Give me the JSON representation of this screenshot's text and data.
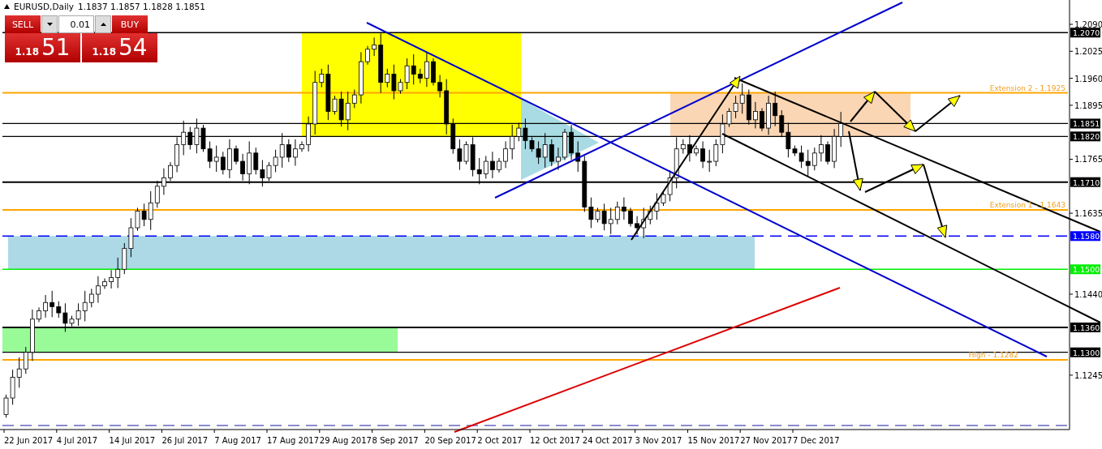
{
  "symbol": {
    "title": "EURUSD,Daily",
    "ohlc": "1.1837 1.1857 1.1828 1.1851"
  },
  "trade_panel": {
    "sell_label": "SELL",
    "buy_label": "BUY",
    "lot": "0.01",
    "sell_price": {
      "prefix": "1.18",
      "big": "51"
    },
    "buy_price": {
      "prefix": "1.18",
      "big": "54"
    }
  },
  "y_ticks": [
    "1.2090",
    "1.2025",
    "1.1960",
    "1.1895",
    "1.1765",
    "1.1635",
    "1.1440",
    "1.1245"
  ],
  "price_labels": [
    {
      "text": "1.2070",
      "color": "#000000"
    },
    {
      "text": "1.1851",
      "color": "#000000"
    },
    {
      "text": "1.1820",
      "color": "#000000"
    },
    {
      "text": "1.1710",
      "color": "#000000"
    },
    {
      "text": "1.1580",
      "color": "#0000ff"
    },
    {
      "text": "1.1500",
      "color": "#00ee00"
    },
    {
      "text": "1.1360",
      "color": "#000000"
    },
    {
      "text": "1.1300",
      "color": "#000000"
    }
  ],
  "line_notes": [
    "Extension 2 - 1.1925",
    "Extension 1 - 1.1643",
    "High - 1.1282"
  ],
  "x_labels": [
    "22 Jun 2017",
    "4 Jul 2017",
    "14 Jul 2017",
    "26 Jul 2017",
    "7 Aug 2017",
    "17 Aug 2017",
    "29 Aug 2017",
    "8 Sep 2017",
    "20 Sep 2017",
    "2 Oct 2017",
    "12 Oct 2017",
    "24 Oct 2017",
    "3 Nov 2017",
    "15 Nov 2017",
    "27 Nov 2017",
    "7 Dec 2017"
  ]
}
